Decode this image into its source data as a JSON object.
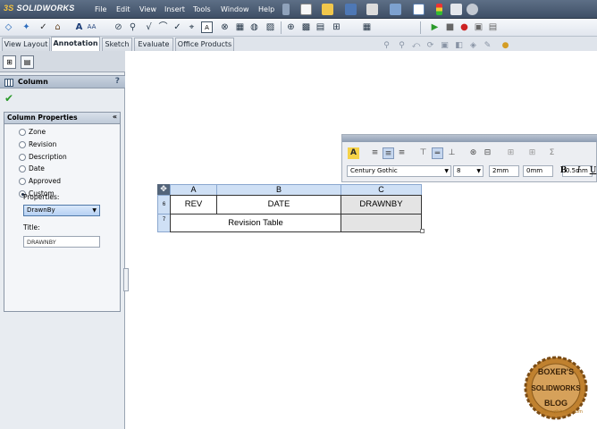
{
  "app": {
    "logo_prefix": "3S",
    "logo": "SOLIDWORKS"
  },
  "menu": [
    "File",
    "Edit",
    "View",
    "Insert",
    "Tools",
    "Window",
    "Help"
  ],
  "tabs": [
    "View Layout",
    "Annotation",
    "Sketch",
    "Evaluate",
    "Office Products"
  ],
  "active_tab": "Annotation",
  "property_manager": {
    "title": "Column",
    "help": "?",
    "group_title": "Column Properties",
    "options": [
      "Zone",
      "Revision",
      "Description",
      "Date",
      "Approved",
      "Custom"
    ],
    "selected_option": "Custom",
    "properties_label": "Properties:",
    "properties_value": "DrawnBy",
    "title_label": "Title:",
    "title_value": "DRAWNBY"
  },
  "format_toolbar": {
    "font": "Century Gothic",
    "size": "8",
    "gap1": "2mm",
    "gap2": "0mm",
    "line_width": "0.5mm",
    "bold": "B",
    "italic": "I",
    "underline": "U"
  },
  "revision_table": {
    "columns": [
      "A",
      "B",
      "C"
    ],
    "rows": [
      {
        "num": "6",
        "cells": [
          "REV",
          "DATE",
          "DRAWNBY"
        ]
      },
      {
        "num": "7",
        "cells": [
          "Revision Table"
        ]
      }
    ]
  },
  "watermark": {
    "top": "BOXER'S",
    "middle": "SOLIDWORKS",
    "bottom": "BLOG",
    "url": "www.gfxboxer.com"
  }
}
